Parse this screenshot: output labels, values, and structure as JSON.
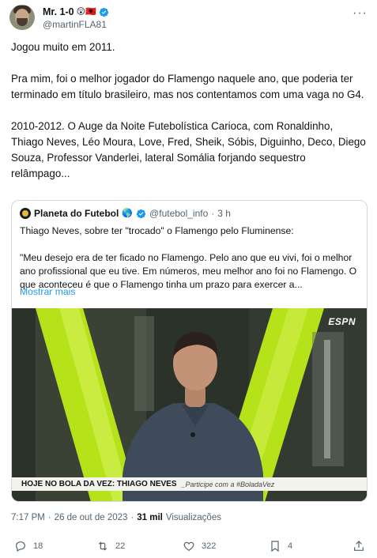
{
  "author": {
    "display_name": "Mr. 1-0",
    "emojis": "😲🇦🇱",
    "handle": "@martinFLA81"
  },
  "tweet": {
    "text": "Jogou muito em 2011.\n\nPra mim, foi o melhor jogador do Flamengo naquele ano, que poderia ter terminado em título brasileiro, mas nos contentamos com uma vaga no G4.\n\n2010-2012. O Auge da Noite Futebolística Carioca, com Ronaldinho, Thiago Neves, Léo Moura, Love, Fred, Sheik, Sóbis, Diguinho, Deco, Diego Souza, Professor Vanderlei, lateral Somália forjando sequestro relâmpago..."
  },
  "quote": {
    "name": "Planeta do Futebol",
    "emoji": "🌎",
    "handle": "@futebol_info",
    "dot": "·",
    "time": "3 h",
    "text": "Thiago Neves, sobre ter \"trocado\" o Flamengo pelo Fluminense:\n\n\"Meu desejo era de ter ficado no Flamengo. Pelo ano que eu vivi, foi o melhor ano profissional que eu tive. Em números, meu melhor ano foi no Flamengo. O que aconteceu é que o Flamengo tinha um prazo para exercer a...",
    "show_more": "Mostrar mais",
    "media": {
      "channel_logo": "ESPN",
      "banner_main": "HOJE NO BOLA DA VEZ: THIAGO NEVES",
      "banner_sub": "_Participe com a #BoladaVez"
    }
  },
  "meta": {
    "time": "7:17 PM",
    "dot1": "·",
    "date": "26 de out de 2023",
    "dot2": "·",
    "views": "31 mil",
    "views_label": "Visualizações"
  },
  "actions": {
    "replies": "18",
    "retweets": "22",
    "likes": "322",
    "bookmarks": "4"
  },
  "colors": {
    "accent": "#1d9bf0",
    "muted": "#536471",
    "text": "#0f1419",
    "lime": "#b6e21a"
  }
}
